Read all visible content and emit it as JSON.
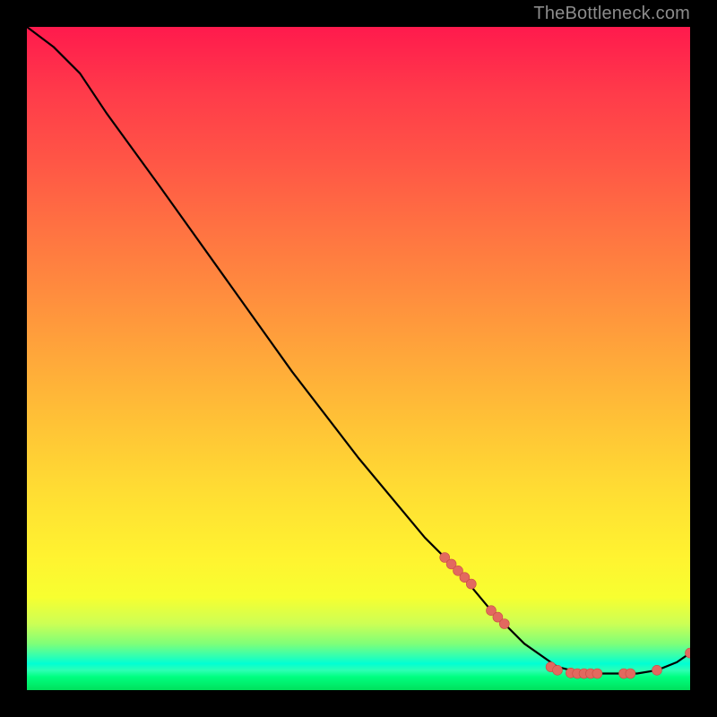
{
  "watermark": "TheBottleneck.com",
  "colors": {
    "curve_stroke": "#000000",
    "marker_fill": "#e2695f",
    "marker_stroke": "#c94d45",
    "gradient_top": "#ff1a4d",
    "gradient_bottom": "#00e05c"
  },
  "chart_data": {
    "type": "line",
    "title": "",
    "xlabel": "",
    "ylabel": "",
    "xlim": [
      0,
      100
    ],
    "ylim": [
      0,
      100
    ],
    "grid": false,
    "curve": [
      {
        "x": 0,
        "y": 100
      },
      {
        "x": 4,
        "y": 97
      },
      {
        "x": 8,
        "y": 93
      },
      {
        "x": 12,
        "y": 87
      },
      {
        "x": 20,
        "y": 76
      },
      {
        "x": 30,
        "y": 62
      },
      {
        "x": 40,
        "y": 48
      },
      {
        "x": 50,
        "y": 35
      },
      {
        "x": 60,
        "y": 23
      },
      {
        "x": 65,
        "y": 18
      },
      {
        "x": 70,
        "y": 12
      },
      {
        "x": 75,
        "y": 7
      },
      {
        "x": 80,
        "y": 3.5
      },
      {
        "x": 84,
        "y": 2.5
      },
      {
        "x": 88,
        "y": 2.5
      },
      {
        "x": 92,
        "y": 2.5
      },
      {
        "x": 95,
        "y": 3
      },
      {
        "x": 98,
        "y": 4.2
      },
      {
        "x": 100,
        "y": 5.6
      }
    ],
    "markers": [
      {
        "x": 63,
        "y": 20
      },
      {
        "x": 64,
        "y": 19
      },
      {
        "x": 65,
        "y": 18
      },
      {
        "x": 66,
        "y": 17
      },
      {
        "x": 67,
        "y": 16
      },
      {
        "x": 70,
        "y": 12
      },
      {
        "x": 71,
        "y": 11
      },
      {
        "x": 72,
        "y": 10
      },
      {
        "x": 79,
        "y": 3.5
      },
      {
        "x": 80,
        "y": 3
      },
      {
        "x": 82,
        "y": 2.6
      },
      {
        "x": 83,
        "y": 2.5
      },
      {
        "x": 84,
        "y": 2.5
      },
      {
        "x": 85,
        "y": 2.5
      },
      {
        "x": 86,
        "y": 2.5
      },
      {
        "x": 90,
        "y": 2.5
      },
      {
        "x": 91,
        "y": 2.5
      },
      {
        "x": 95,
        "y": 3
      },
      {
        "x": 100,
        "y": 5.6
      }
    ]
  }
}
